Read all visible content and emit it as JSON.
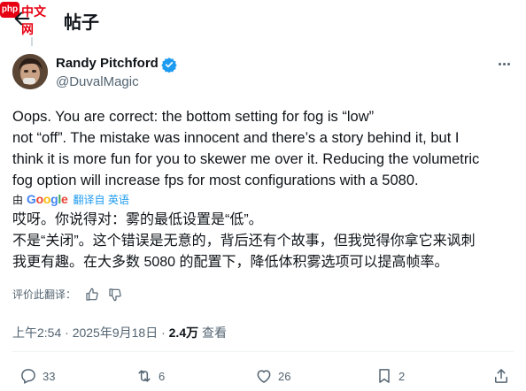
{
  "watermark": {
    "badge": "php",
    "text": "中文网"
  },
  "header": {
    "title": "帖子"
  },
  "author": {
    "name": "Randy Pitchford",
    "handle": "@DuvalMagic"
  },
  "tweet": {
    "lines": [
      "Oops. You are correct: the bottom setting for fog is “low”",
      "not “off”. The mistake was innocent and there’s a story behind it, but I",
      "think it is more fun for you to skewer me over it. Reducing the volumetric",
      "fog option will increase fps for most configurations with a 5080."
    ]
  },
  "translation": {
    "by": "由",
    "provider": "Google",
    "label": "翻译自 英语",
    "lines": [
      "哎呀。你说得对：雾的最低设置是“低”。",
      "不是“关闭”。这个错误是无意的，背后还有个故事，但我觉得你拿它来讽刺",
      "我更有趣。在大多数 5080 的配置下，降低体积雾选项可以提高帧率。"
    ],
    "rate_label": "评价此翻译："
  },
  "meta": {
    "time": "上午2:54 · 2025年9月18日 · ",
    "views_count": "2.4万",
    "views_label": " 查看"
  },
  "actions": {
    "replies": "33",
    "retweets": "6",
    "likes": "26",
    "bookmarks": "2"
  },
  "colors": {
    "accent": "#1d9bf0",
    "verified": "#1d9bf0",
    "secondary_text": "#536471"
  }
}
